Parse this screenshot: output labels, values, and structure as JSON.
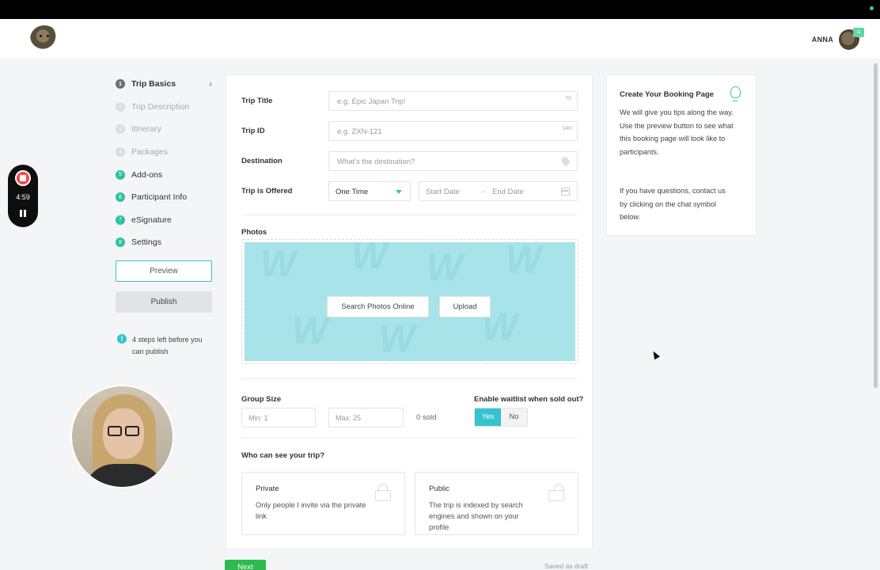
{
  "header": {
    "user_name": "ANNA"
  },
  "recorder": {
    "time": "4:59"
  },
  "sidebar": {
    "steps": [
      {
        "num": "1",
        "label": "Trip Basics",
        "state": "active"
      },
      {
        "num": "2",
        "label": "Trip Description",
        "state": "pending"
      },
      {
        "num": "3",
        "label": "Itinerary",
        "state": "pending"
      },
      {
        "num": "4",
        "label": "Packages",
        "state": "pending"
      },
      {
        "num": "5",
        "label": "Add-ons",
        "state": "done"
      },
      {
        "num": "6",
        "label": "Participant Info",
        "state": "done"
      },
      {
        "num": "7",
        "label": "eSignature",
        "state": "done"
      },
      {
        "num": "8",
        "label": "Settings",
        "state": "done"
      }
    ],
    "preview_label": "Preview",
    "publish_label": "Publish",
    "info_text": "4 steps left before you can publish"
  },
  "form": {
    "trip_title": {
      "label": "Trip Title",
      "placeholder": "e.g. Epic Japan Trip!",
      "count": "70"
    },
    "trip_id": {
      "label": "Trip ID",
      "placeholder": "e.g. ZXN-121",
      "count": "140"
    },
    "destination": {
      "label": "Destination",
      "placeholder": "What's the destination?"
    },
    "offered": {
      "label": "Trip is Offered",
      "value": "One Time",
      "start_placeholder": "Start Date",
      "end_placeholder": "End Date",
      "arrow": "→"
    },
    "photos": {
      "label": "Photos",
      "search_label": "Search Photos Online",
      "upload_label": "Upload"
    },
    "group_size": {
      "label": "Group Size",
      "min_placeholder": "Min: 1",
      "max_placeholder": "Max: 25",
      "sold": "0 sold"
    },
    "waitlist": {
      "label": "Enable waitlist when sold out?",
      "yes": "Yes",
      "no": "No",
      "selected": "Yes"
    },
    "visibility": {
      "label": "Who can see your trip?",
      "private": {
        "title": "Private",
        "desc": "Only people I invite via the private link"
      },
      "public": {
        "title": "Public",
        "desc": "The trip is indexed by search engines and shown on your profile"
      }
    }
  },
  "tips": {
    "title": "Create Your Booking Page",
    "p1": "We will give you tips along the way. Use the preview button to see what this booking page will look like to participants.",
    "p2": "If you have questions, contact us by clicking on the chat symbol below."
  },
  "footer": {
    "next_label": "Next",
    "draft_label": "Saved as draft"
  },
  "colors": {
    "accent": "#35c3d0",
    "done": "#2cc2a0",
    "next": "#2fb94f"
  }
}
